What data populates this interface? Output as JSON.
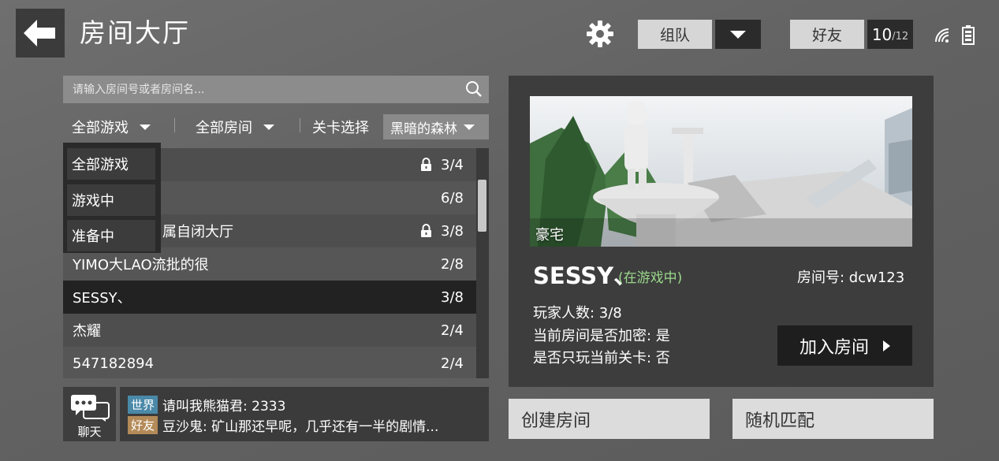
{
  "header": {
    "title": "房间大厅",
    "team_label": "组队",
    "friends_label": "好友",
    "friends_online": "10",
    "friends_max": "/12"
  },
  "search": {
    "placeholder": "请输入房间号或者房间名..."
  },
  "filters": {
    "game_filter": "全部游戏",
    "room_filter": "全部房间",
    "level_label": "关卡选择",
    "level_value": "黑暗的森林"
  },
  "dropdown": {
    "options": [
      "全部游戏",
      "游戏中",
      "准备中"
    ]
  },
  "rooms": [
    {
      "name": "",
      "count": "3/4",
      "locked": true
    },
    {
      "name": "",
      "count": "6/8",
      "locked": false
    },
    {
      "name": "属自闭大厅",
      "count": "3/8",
      "locked": true
    },
    {
      "name": "YIMO大LAO流批的很",
      "count": "2/8",
      "locked": false
    },
    {
      "name": "SESSY、",
      "count": "3/8",
      "locked": false,
      "selected": true
    },
    {
      "name": "杰耀",
      "count": "2/4",
      "locked": false
    },
    {
      "name": "547182894",
      "count": "2/4",
      "locked": false
    }
  ],
  "chat": {
    "button_label": "聊天",
    "messages": [
      {
        "channel": "世界",
        "text": "请叫我熊猫君: 2333"
      },
      {
        "channel": "好友",
        "text": "豆沙鬼: 矿山那还早呢，几乎还有一半的剧情..."
      }
    ]
  },
  "detail": {
    "map_name": "豪宅",
    "host_name": "SESSY、",
    "status": "(在游戏中)",
    "room_id": "房间号: dcw123",
    "players": "玩家人数: 3/8",
    "locked": "当前房间是否加密: 是",
    "level_only": "是否只玩当前关卡: 否",
    "join_label": "加入房间"
  },
  "actions": {
    "create_label": "创建房间",
    "random_label": "随机匹配"
  },
  "colors": {
    "status_green": "#9bd88b",
    "world_badge": "#4a89a8",
    "friend_badge": "#b48a58"
  }
}
